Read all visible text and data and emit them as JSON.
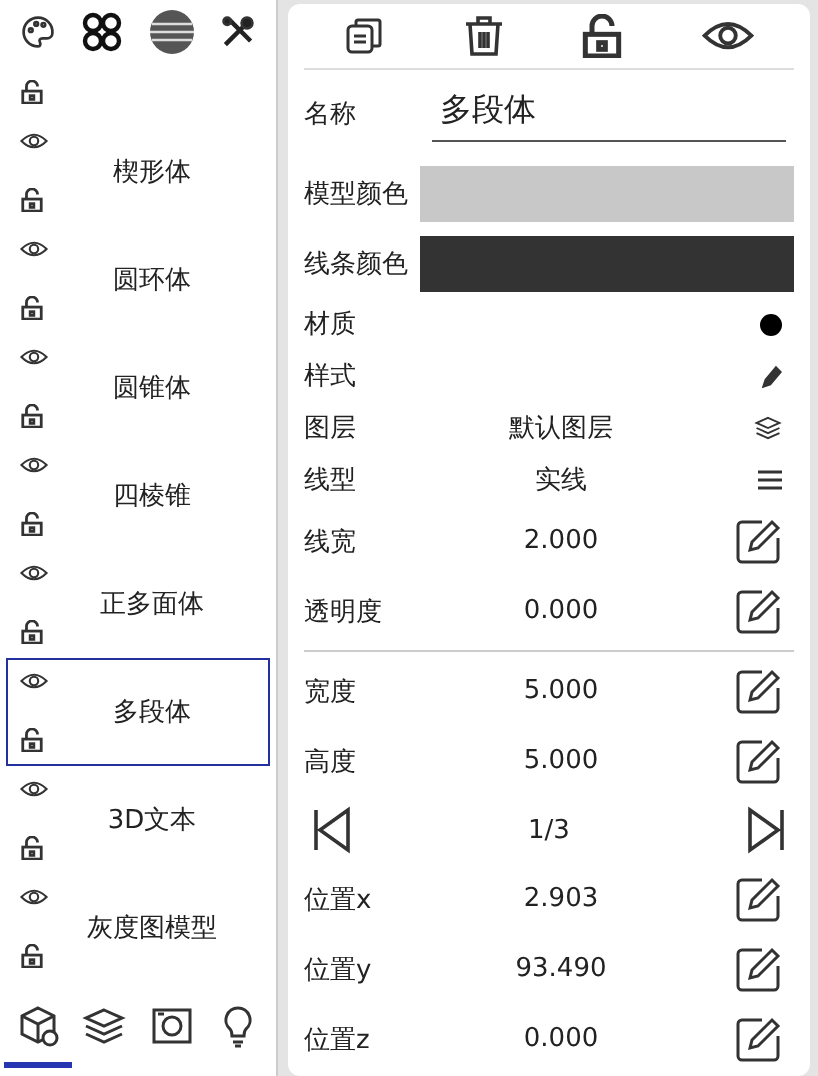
{
  "object_list": {
    "items": [
      {
        "label": "楔形体",
        "selected": false
      },
      {
        "label": "圆环体",
        "selected": false
      },
      {
        "label": "圆锥体",
        "selected": false
      },
      {
        "label": "四棱锥",
        "selected": false
      },
      {
        "label": "正多面体",
        "selected": false
      },
      {
        "label": "多段体",
        "selected": true
      },
      {
        "label": "3D文本",
        "selected": false
      },
      {
        "label": "灰度图模型",
        "selected": false
      }
    ],
    "bottom_tabs": [
      {
        "selected": true
      },
      {
        "selected": false
      },
      {
        "selected": false
      },
      {
        "selected": false
      }
    ]
  },
  "properties": {
    "name": {
      "label": "名称",
      "value": "多段体"
    },
    "colors": [
      {
        "label": "模型颜色",
        "color": "#c8c8c8"
      },
      {
        "label": "线条颜色",
        "color": "#333333"
      }
    ],
    "rows": [
      {
        "kind": "material",
        "label": "材质"
      },
      {
        "kind": "style",
        "label": "样式"
      },
      {
        "kind": "layer",
        "label": "图层",
        "value": "默认图层"
      },
      {
        "kind": "linetype",
        "label": "线型",
        "value": "实线"
      },
      {
        "kind": "edit",
        "label": "线宽",
        "value": "2.000"
      },
      {
        "kind": "edit",
        "label": "透明度",
        "value": "0.000"
      },
      {
        "kind": "divider"
      },
      {
        "kind": "edit",
        "label": "宽度",
        "value": "5.000"
      },
      {
        "kind": "edit",
        "label": "高度",
        "value": "5.000"
      },
      {
        "kind": "pager",
        "value": "1/3"
      },
      {
        "kind": "edit",
        "label": "位置x",
        "value": "2.903"
      },
      {
        "kind": "edit",
        "label": "位置y",
        "value": "93.490"
      },
      {
        "kind": "edit",
        "label": "位置z",
        "value": "0.000"
      }
    ]
  }
}
